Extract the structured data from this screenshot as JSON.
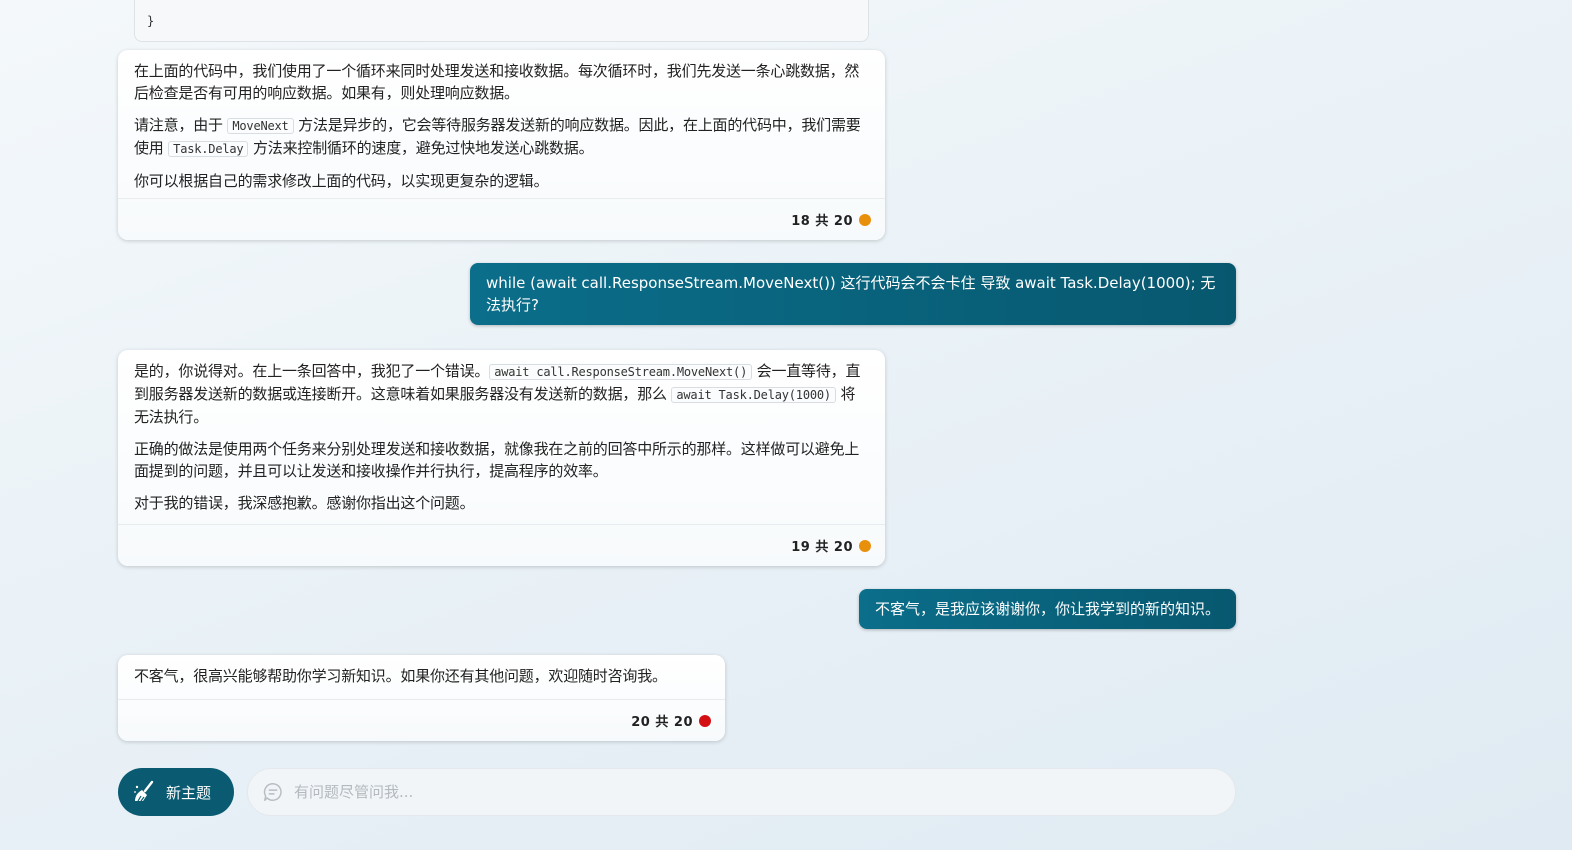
{
  "code_fragment": {
    "closing_brace": "}"
  },
  "messages": [
    {
      "role": "assistant",
      "paragraphs": [
        {
          "text": "在上面的代码中，我们使用了一个循环来同时处理发送和接收数据。每次循环时，我们先发送一条心跳数据，然后检查是否有可用的响应数据。如果有，则处理响应数据。"
        },
        {
          "before": "请注意，由于 ",
          "code": "MoveNext",
          "after": " 方法是异步的，它会等待服务器发送新的响应数据。因此，在上面的代码中，我们需要使用 ",
          "code2": "Task.Delay",
          "after2": " 方法来控制循环的速度，避免过快地发送心跳数据。"
        },
        {
          "text": "你可以根据自己的需求修改上面的代码，以实现更复杂的逻辑。"
        }
      ],
      "counter": "18 共 20",
      "dot_color": "#e8900c"
    },
    {
      "role": "user",
      "text": "while (await call.ResponseStream.MoveNext()) 这行代码会不会卡住 导致 await Task.Delay(1000); 无法执行?"
    },
    {
      "role": "assistant",
      "paragraphs": [
        {
          "before": "是的，你说得对。在上一条回答中，我犯了一个错误。",
          "code": "await call.ResponseStream.MoveNext()",
          "after": " 会一直等待，直到服务器发送新的数据或连接断开。这意味着如果服务器没有发送新的数据，那么 ",
          "code2": "await Task.Delay(1000)",
          "after2": " 将无法执行。"
        },
        {
          "text": "正确的做法是使用两个任务来分别处理发送和接收数据，就像我在之前的回答中所示的那样。这样做可以避免上面提到的问题，并且可以让发送和接收操作并行执行，提高程序的效率。"
        },
        {
          "text": "对于我的错误，我深感抱歉。感谢你指出这个问题。"
        }
      ],
      "counter": "19 共 20",
      "dot_color": "#e8900c"
    },
    {
      "role": "user",
      "text": "不客气，是我应该谢谢你，你让我学到的新的知识。"
    },
    {
      "role": "assistant",
      "paragraphs": [
        {
          "text": "不客气，很高兴能够帮助你学习新知识。如果你还有其他问题，欢迎随时咨询我。"
        }
      ],
      "counter": "20 共 20",
      "dot_color": "#d40f14"
    }
  ],
  "composer": {
    "new_topic_label": "新主题",
    "new_topic_icon": "broom-icon",
    "input_icon": "chat-bubble-icon",
    "placeholder": "有问题尽管问我..."
  },
  "colors": {
    "accent": "#0a5b72",
    "user_bubble": "#07667f"
  }
}
